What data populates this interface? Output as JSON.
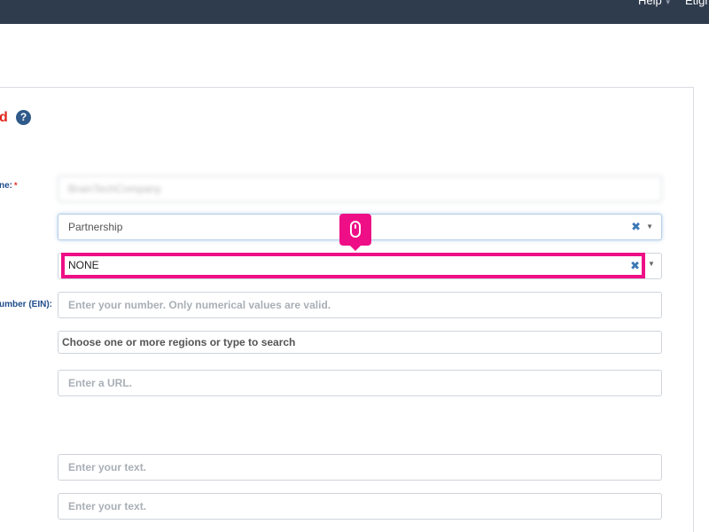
{
  "nav": {
    "help": "Help",
    "user": "Etign"
  },
  "section": {
    "title_fragment": "d",
    "help_glyph": "?"
  },
  "labels": {
    "name": "ne:",
    "name_required": "*",
    "ein": "umber (EIN):"
  },
  "fields": {
    "name_value": "BrainTechCompany",
    "entity_type": "Partnership",
    "classification": "NONE",
    "ein_placeholder": "Enter your number. Only numerical values are valid.",
    "regions_placeholder": "Choose one or more regions or type to search",
    "url_placeholder": "Enter a URL.",
    "text1_placeholder": "Enter your text.",
    "text2_placeholder": "Enter your text."
  },
  "icons": {
    "clear": "✖",
    "arrow": "▼",
    "caret": "▼"
  },
  "colors": {
    "topbar": "#2f3c4d",
    "highlight": "#ee0f86",
    "label": "#1f4e8c",
    "required": "#e0261b"
  }
}
